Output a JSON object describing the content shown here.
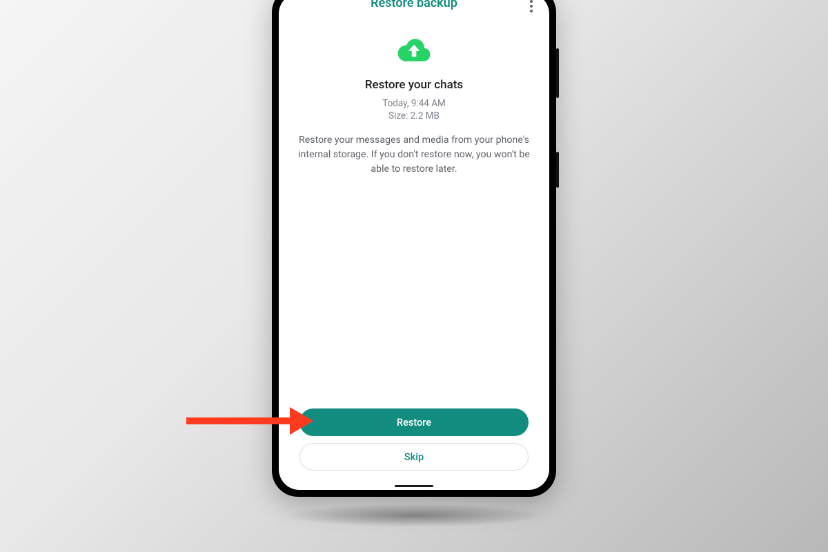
{
  "colors": {
    "accent": "#128C7E",
    "arrow": "#ff3b1f"
  },
  "header": {
    "title": "Restore backup",
    "menu_icon": "more-vert-icon"
  },
  "cloud_icon": "cloud-upload-icon",
  "subtitle": "Restore your chats",
  "backup_meta": {
    "line1": "Today, 9:44 AM",
    "line2": "Size: 2.2 MB"
  },
  "description": "Restore your messages and media from your phone's internal storage. If you don't restore now, you won't be able to restore later.",
  "buttons": {
    "primary": "Restore",
    "secondary": "Skip"
  }
}
